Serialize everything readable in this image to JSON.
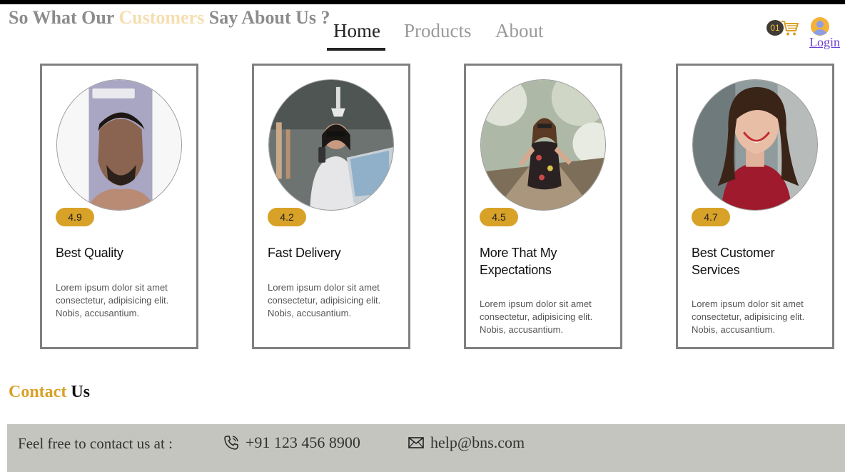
{
  "header": {
    "section_title_part1": "So What Our ",
    "section_title_highlight": "Customers",
    "section_title_part2": " Say About Us ?",
    "nav": [
      {
        "label": "Home",
        "active": true
      },
      {
        "label": "Products",
        "active": false
      },
      {
        "label": "About",
        "active": false
      }
    ],
    "cart_count": "01",
    "login_label": "Login"
  },
  "cards": [
    {
      "rating": "4.9",
      "title": "Best Quality",
      "text": "Lorem ipsum dolor sit amet consectetur, adipisicing elit. Nobis, accusantium."
    },
    {
      "rating": "4.2",
      "title": "Fast Delivery",
      "text": "Lorem ipsum dolor sit amet consectetur, adipisicing elit. Nobis, accusantium."
    },
    {
      "rating": "4.5",
      "title": "More That My Expectations",
      "text": "Lorem ipsum dolor sit amet consectetur, adipisicing elit. Nobis, accusantium."
    },
    {
      "rating": "4.7",
      "title": "Best Customer Services",
      "text": "Lorem ipsum dolor sit amet consectetur, adipisicing elit. Nobis, accusantium."
    }
  ],
  "contact": {
    "title_highlight": "Contact",
    "title_rest": " Us",
    "lead": "Feel free to contact us at :",
    "phone": "+91 123 456 8900",
    "email": "help@bns.com"
  },
  "colors": {
    "accent": "#d8a127",
    "contact_bar": "#c5c5c0",
    "card_border": "#808080"
  },
  "icons": {
    "cart": "shopping-cart-icon",
    "user": "user-avatar-icon",
    "phone": "phone-icon",
    "email": "envelope-icon"
  }
}
